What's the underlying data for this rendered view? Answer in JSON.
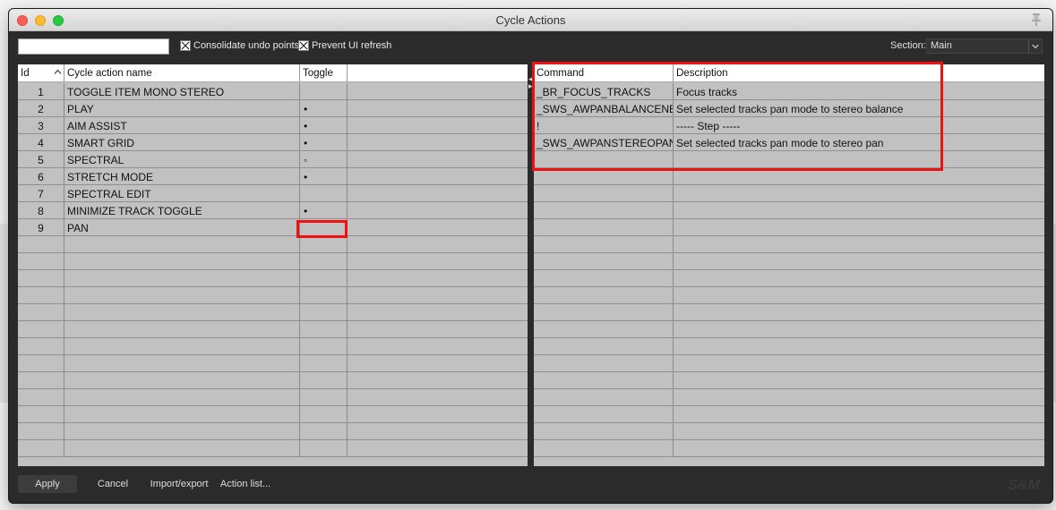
{
  "window": {
    "title": "Cycle Actions"
  },
  "toolbar": {
    "filter_value": "",
    "consolidate_label": "Consolidate undo points",
    "consolidate_checked": true,
    "prevent_label": "Prevent UI refresh",
    "prevent_checked": true,
    "section_label": "Section:",
    "section_value": "Main"
  },
  "left_table": {
    "headers": {
      "id": "Id",
      "name": "Cycle action name",
      "toggle": "Toggle"
    },
    "rows": [
      {
        "id": "1",
        "name": "TOGGLE ITEM MONO STEREO",
        "toggle": ""
      },
      {
        "id": "2",
        "name": "PLAY",
        "toggle": "•"
      },
      {
        "id": "3",
        "name": "AIM ASSIST",
        "toggle": "•"
      },
      {
        "id": "4",
        "name": "SMART GRID",
        "toggle": "•"
      },
      {
        "id": "5",
        "name": "SPECTRAL",
        "toggle": "◦"
      },
      {
        "id": "6",
        "name": "STRETCH MODE",
        "toggle": "•"
      },
      {
        "id": "7",
        "name": "SPECTRAL EDIT",
        "toggle": ""
      },
      {
        "id": "8",
        "name": "MINIMIZE TRACK TOGGLE",
        "toggle": "•"
      },
      {
        "id": "9",
        "name": "PAN",
        "toggle": ""
      }
    ]
  },
  "right_table": {
    "headers": {
      "command": "Command",
      "description": "Description"
    },
    "rows": [
      {
        "command": "_BR_FOCUS_TRACKS",
        "description": "Focus tracks"
      },
      {
        "command": "_SWS_AWPANBALANCENEW",
        "description": "Set selected tracks pan mode to stereo balance"
      },
      {
        "command": "!",
        "description": "----- Step -----"
      },
      {
        "command": "_SWS_AWPANSTEREOPAN",
        "description": "Set selected tracks pan mode to stereo pan"
      }
    ]
  },
  "buttons": {
    "apply": "Apply",
    "cancel": "Cancel",
    "import_export": "Import/export",
    "action_list": "Action list..."
  },
  "brand": "S&M",
  "colors": {
    "window_bg": "#2b2b2b",
    "grid_bg": "#c1c1c1",
    "highlight": "#ee1111"
  }
}
